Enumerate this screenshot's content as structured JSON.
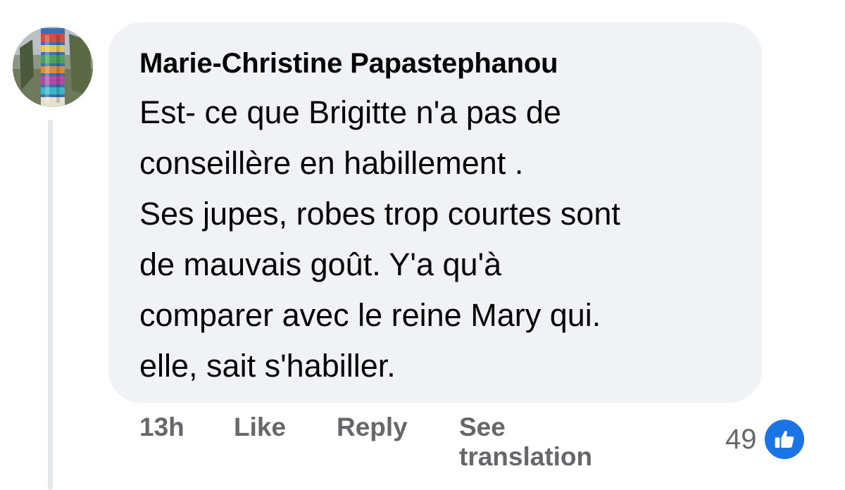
{
  "comment": {
    "author": "Marie-Christine Papastephanou",
    "lines": [
      "Est- ce que Brigitte n'a pas de",
      "conseillère en habillement .",
      "Ses jupes, robes trop courtes sont",
      "de mauvais goût. Y'a qu'à",
      "comparer avec le reine Mary qui.",
      "elle, sait s'habiller."
    ],
    "avatar_icon": "profile-photo-colorful-knitted-tree"
  },
  "actions": {
    "time": "13h",
    "like_label": "Like",
    "reply_label": "Reply",
    "see_translation_label": "See translation"
  },
  "reactions": {
    "count": "49",
    "icon": "thumbs-up-icon",
    "color": "#1b74e4"
  }
}
